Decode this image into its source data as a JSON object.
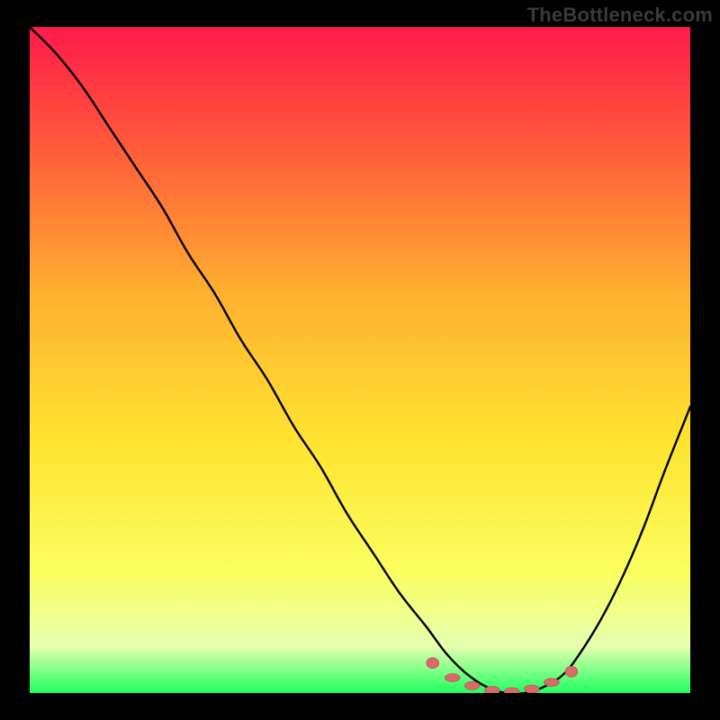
{
  "watermark": "TheBottleneck.com",
  "colors": {
    "page_bg": "#000000",
    "gradient_top": "#ff1a4a",
    "gradient_mid_upper": "#ff5a3a",
    "gradient_mid": "#ffb030",
    "gradient_mid_lower": "#ffe330",
    "gradient_lower": "#fbff60",
    "gradient_bottom_tint": "#e6ffb0",
    "gradient_bottom": "#20ff60",
    "curve": "#000000",
    "marker_fill": "#d86a6a",
    "marker_stroke": "#b84f4f"
  },
  "chart_data": {
    "type": "line",
    "title": "",
    "xlabel": "",
    "ylabel": "",
    "xlim": [
      0,
      100
    ],
    "ylim": [
      0,
      100
    ],
    "grid": false,
    "series": [
      {
        "name": "bottleneck-curve",
        "x": [
          0,
          4,
          8,
          12,
          16,
          20,
          24,
          28,
          32,
          36,
          40,
          44,
          48,
          52,
          56,
          60,
          63,
          66,
          69,
          72,
          75,
          78,
          81,
          84,
          87,
          90,
          93,
          96,
          100
        ],
        "y": [
          100,
          96,
          91,
          85,
          79,
          73,
          66,
          60,
          53,
          47,
          40,
          34,
          27,
          21,
          15,
          10,
          6,
          3,
          1,
          0,
          0,
          1,
          3,
          7,
          12,
          18,
          25,
          33,
          43
        ]
      }
    ],
    "markers": {
      "name": "optimal-range",
      "x": [
        61,
        64,
        67,
        70,
        73,
        76,
        79,
        82
      ],
      "y": [
        4.5,
        2.3,
        1.1,
        0.4,
        0.2,
        0.6,
        1.6,
        3.2
      ]
    }
  }
}
